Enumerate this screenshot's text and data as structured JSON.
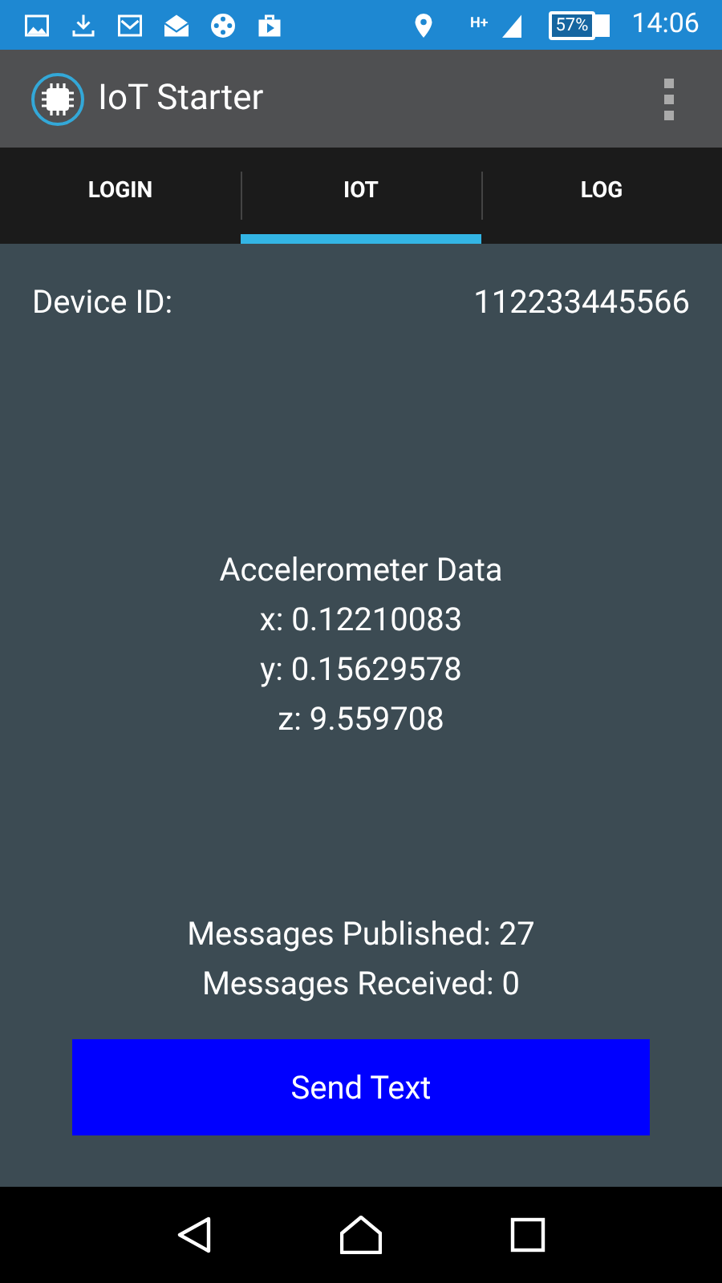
{
  "status_bar": {
    "network": "H+",
    "battery": "57%",
    "time": "14:06"
  },
  "app_bar": {
    "title": "IoT Starter"
  },
  "tabs": [
    {
      "label": "LOGIN",
      "selected": false
    },
    {
      "label": "IOT",
      "selected": true
    },
    {
      "label": "LOG",
      "selected": false
    }
  ],
  "device": {
    "label": "Device ID:",
    "value": "112233445566"
  },
  "accelerometer": {
    "title": "Accelerometer Data",
    "lines": [
      "x: 0.12210083",
      "y: 0.15629578",
      "z: 9.559708"
    ]
  },
  "messages": [
    "Messages Published: 27",
    "Messages Received: 0"
  ],
  "button": "Send Text"
}
